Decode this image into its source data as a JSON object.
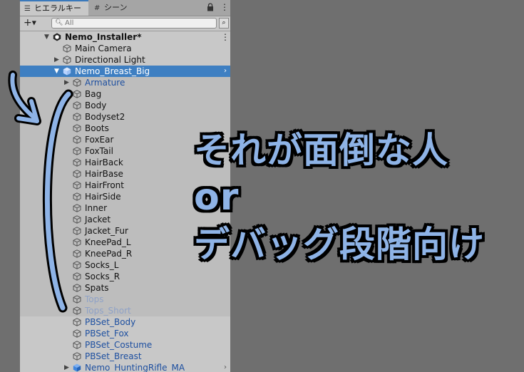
{
  "tabs": [
    {
      "label": "ヒエラルキー",
      "icon": "hierarchy-icon"
    },
    {
      "label": "シーン",
      "icon": "scene-icon"
    }
  ],
  "toolbar": {
    "add_label": "+",
    "search_placeholder": "All"
  },
  "colors": {
    "selection": "#3e7fc2",
    "prefab_text": "#1d4fa0",
    "annotation": "#8eb3e6",
    "panel_bg": "#c8c8c8"
  },
  "hierarchy": [
    {
      "label": "Nemo_Installer*",
      "depth": 0,
      "arrow": "expanded",
      "icon": "unity-scene-icon",
      "bold": true
    },
    {
      "label": "Main Camera",
      "depth": 1,
      "icon": "gameobject-icon"
    },
    {
      "label": "Directional Light",
      "depth": 1,
      "arrow": "collapsed",
      "icon": "gameobject-icon"
    },
    {
      "label": "Nemo_Breast_Big",
      "depth": 1,
      "arrow": "expanded",
      "icon": "prefab-icon",
      "selected": true
    },
    {
      "label": "Armature",
      "depth": 2,
      "arrow": "collapsed",
      "icon": "gameobject-icon",
      "prefab": true
    },
    {
      "label": "Bag",
      "depth": 2,
      "icon": "gameobject-icon"
    },
    {
      "label": "Body",
      "depth": 2,
      "icon": "gameobject-icon"
    },
    {
      "label": "Bodyset2",
      "depth": 2,
      "icon": "gameobject-icon"
    },
    {
      "label": "Boots",
      "depth": 2,
      "icon": "gameobject-icon"
    },
    {
      "label": "FoxEar",
      "depth": 2,
      "icon": "gameobject-icon"
    },
    {
      "label": "FoxTail",
      "depth": 2,
      "icon": "gameobject-icon"
    },
    {
      "label": "HairBack",
      "depth": 2,
      "icon": "gameobject-icon"
    },
    {
      "label": "HairBase",
      "depth": 2,
      "icon": "gameobject-icon"
    },
    {
      "label": "HairFront",
      "depth": 2,
      "icon": "gameobject-icon"
    },
    {
      "label": "HairSide",
      "depth": 2,
      "icon": "gameobject-icon"
    },
    {
      "label": "Inner",
      "depth": 2,
      "icon": "gameobject-icon"
    },
    {
      "label": "Jacket",
      "depth": 2,
      "icon": "gameobject-icon"
    },
    {
      "label": "Jacket_Fur",
      "depth": 2,
      "icon": "gameobject-icon"
    },
    {
      "label": "KneePad_L",
      "depth": 2,
      "icon": "gameobject-icon"
    },
    {
      "label": "KneePad_R",
      "depth": 2,
      "icon": "gameobject-icon"
    },
    {
      "label": "Socks_L",
      "depth": 2,
      "icon": "gameobject-icon"
    },
    {
      "label": "Socks_R",
      "depth": 2,
      "icon": "gameobject-icon"
    },
    {
      "label": "Spats",
      "depth": 2,
      "icon": "gameobject-icon"
    },
    {
      "label": "Tops",
      "depth": 2,
      "icon": "gameobject-icon",
      "disabled": true
    },
    {
      "label": "Tops_Short",
      "depth": 2,
      "icon": "gameobject-icon",
      "disabled": true
    },
    {
      "label": "PBSet_Body",
      "depth": 2,
      "icon": "gameobject-icon",
      "prefab": true
    },
    {
      "label": "PBSet_Fox",
      "depth": 2,
      "icon": "gameobject-icon",
      "prefab": true
    },
    {
      "label": "PBSet_Costume",
      "depth": 2,
      "icon": "gameobject-icon",
      "prefab": true
    },
    {
      "label": "PBSet_Breast",
      "depth": 2,
      "icon": "gameobject-icon",
      "prefab": true
    },
    {
      "label": "Nemo_HuntingRifle_MA",
      "depth": 2,
      "arrow": "collapsed",
      "icon": "prefab-icon",
      "prefab": true
    }
  ],
  "overlay": {
    "line1": "それが面倒な人",
    "line2": "or",
    "line3": "デバッグ段階向け"
  }
}
